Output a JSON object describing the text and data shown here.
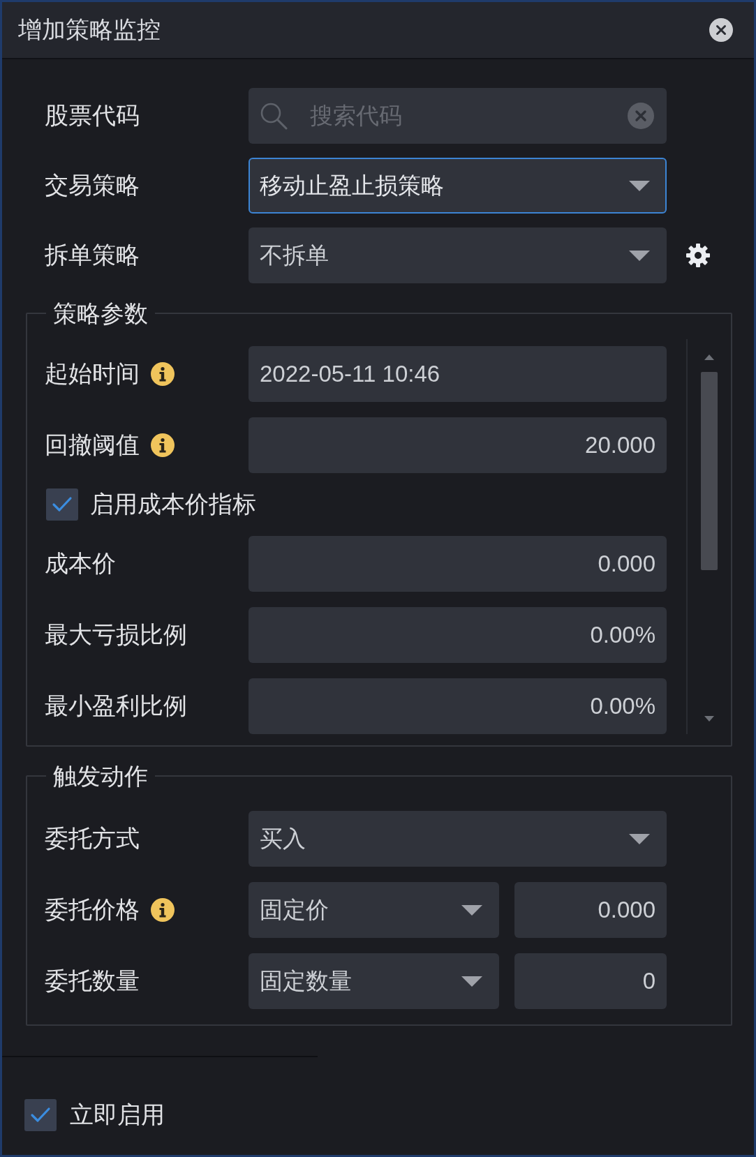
{
  "window": {
    "title": "增加策略监控"
  },
  "form": [
    {
      "kind": "search",
      "label": "股票代码",
      "placeholder": "搜索代码",
      "focused": false,
      "settings": false
    },
    {
      "kind": "select",
      "label": "交易策略",
      "value": "移动止盈止损策略",
      "focused": true,
      "settings": false
    },
    {
      "kind": "select",
      "label": "拆单策略",
      "value": "不拆单",
      "focused": false,
      "settings": true
    }
  ],
  "groups": [
    {
      "title": "策略参数",
      "scrollbar": true,
      "fields": [
        {
          "kind": "text",
          "label": "起始时间",
          "info": true,
          "value": "2022-05-11 10:46"
        },
        {
          "kind": "number",
          "label": "回撤阈值",
          "info": true,
          "value": "20.000"
        },
        {
          "kind": "checkbox",
          "label": "启用成本价指标",
          "checked": true
        },
        {
          "kind": "number",
          "label": "成本价",
          "info": false,
          "value": "0.000"
        },
        {
          "kind": "number",
          "label": "最大亏损比例",
          "info": false,
          "value": "0.00%"
        },
        {
          "kind": "number",
          "label": "最小盈利比例",
          "info": false,
          "value": "0.00%"
        }
      ]
    },
    {
      "title": "触发动作",
      "scrollbar": false,
      "fields": [
        {
          "kind": "select",
          "label": "委托方式",
          "info": false,
          "value": "买入"
        },
        {
          "kind": "select_number",
          "label": "委托价格",
          "info": true,
          "value": "固定价",
          "amount": "0.000"
        },
        {
          "kind": "select_number",
          "label": "委托数量",
          "info": false,
          "value": "固定数量",
          "amount": "0"
        }
      ]
    }
  ],
  "footer": {
    "label": "立即启用",
    "checked": true
  }
}
